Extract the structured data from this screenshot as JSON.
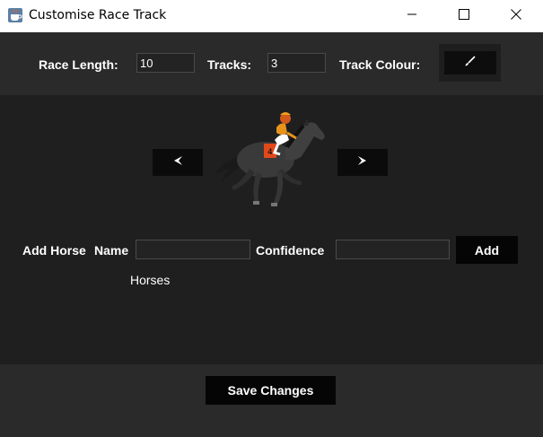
{
  "window": {
    "title": "Customise Race Track",
    "app_icon": "java-cup-icon",
    "controls": [
      "minimize-icon",
      "maximize-icon",
      "close-icon"
    ]
  },
  "settings": {
    "race_length_label": "Race Length:",
    "race_length_value": "10",
    "tracks_label": "Tracks:",
    "tracks_value": "3",
    "track_colour_label": "Track Colour:",
    "track_colour_icon": "paintbrush-icon"
  },
  "horse_selector": {
    "prev_icon": "arrow-left-icon",
    "next_icon": "arrow-right-icon",
    "image": "racehorse-with-jockey"
  },
  "add_horse": {
    "section_label": "Add Horse",
    "name_label": "Name",
    "name_value": "",
    "confidence_label": "Confidence",
    "confidence_value": "",
    "add_button": "Add"
  },
  "horses_label": "Horses",
  "footer": {
    "save_button": "Save Changes"
  },
  "colors": {
    "background": "#1f1f1f",
    "panel": "#2a2a2a",
    "button": "#050505",
    "text": "#ffffff"
  }
}
